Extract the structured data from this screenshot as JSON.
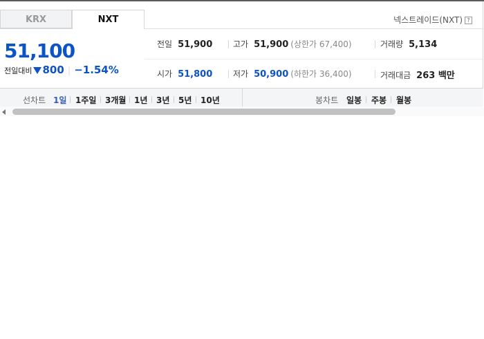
{
  "tabs": [
    {
      "label": "KRX",
      "active": false
    },
    {
      "label": "NXT",
      "active": true
    }
  ],
  "exchange_label": "넥스트레이드(NXT)",
  "help_icon_text": "?",
  "price": "51,100",
  "change": {
    "label": "전일대비",
    "direction": "down",
    "amount": "800",
    "percent": "−1.54%"
  },
  "stats": {
    "prev_close": {
      "label": "전일",
      "value": "51,900"
    },
    "high": {
      "label": "고가",
      "value": "51,900",
      "sub": "(상한가 67,400)"
    },
    "volume": {
      "label": "거래량",
      "value": "5,134"
    },
    "open": {
      "label": "시가",
      "value": "51,800"
    },
    "low": {
      "label": "저가",
      "value": "50,900",
      "sub": "(하한가 36,400)"
    },
    "trade_value": {
      "label": "거래대금",
      "value": "263 백만"
    }
  },
  "line_chart": {
    "label": "선차트",
    "periods": [
      "1일",
      "1주일",
      "3개월",
      "1년",
      "3년",
      "5년",
      "10년"
    ],
    "selected": "1일"
  },
  "candle_chart": {
    "label": "봉차트",
    "periods": [
      "일봉",
      "주봉",
      "월봉"
    ]
  },
  "colors": {
    "price_down": "#0c53c5",
    "selected_period": "#3a5bb5"
  }
}
